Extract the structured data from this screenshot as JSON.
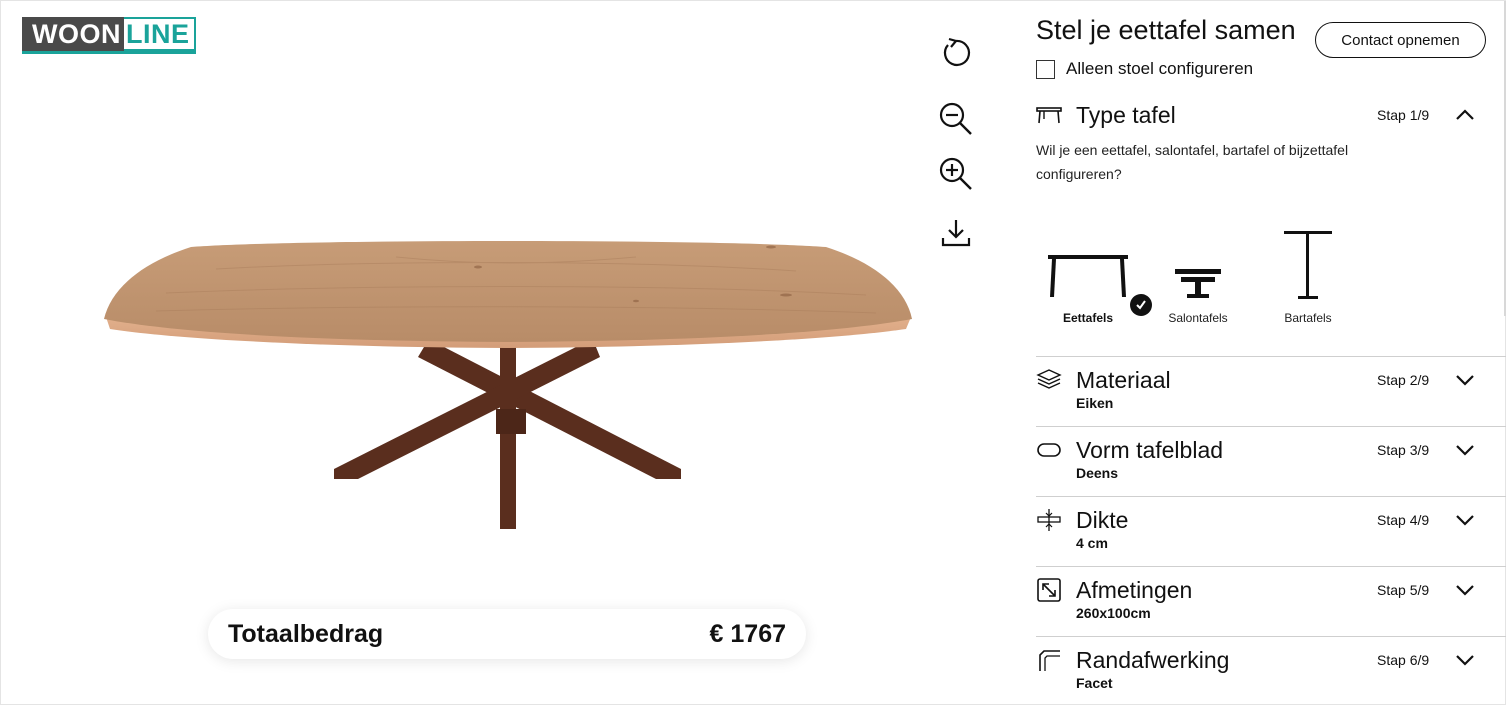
{
  "brand": {
    "logo_dark": "WOON",
    "logo_light": "LINE"
  },
  "viewer": {
    "tools": [
      "rotate-icon",
      "zoom-out-icon",
      "zoom-in-icon",
      "download-icon"
    ]
  },
  "price": {
    "label": "Totaalbedrag",
    "value": "€ 1767"
  },
  "panel": {
    "title": "Stel je eettafel samen",
    "contact_label": "Contact opnemen",
    "chair_only_label": "Alleen stoel configureren",
    "chair_only_checked": false
  },
  "step1": {
    "title": "Type tafel",
    "count": "Stap 1/9",
    "expanded": true,
    "question": "Wil je een eettafel, salontafel, bartafel of bijzettafel configureren?",
    "options": [
      {
        "label": "Eettafels",
        "selected": true
      },
      {
        "label": "Salontafels",
        "selected": false
      },
      {
        "label": "Bartafels",
        "selected": false
      }
    ]
  },
  "steps": [
    {
      "title": "Materiaal",
      "count": "Stap 2/9",
      "value": "Eiken",
      "icon": "layers-icon"
    },
    {
      "title": "Vorm tafelblad",
      "count": "Stap 3/9",
      "value": "Deens",
      "icon": "oval-shape-icon"
    },
    {
      "title": "Dikte",
      "count": "Stap 4/9",
      "value": "4 cm",
      "icon": "thickness-icon"
    },
    {
      "title": "Afmetingen",
      "count": "Stap 5/9",
      "value": "260x100cm",
      "icon": "resize-icon"
    },
    {
      "title": "Randafwerking",
      "count": "Stap 6/9",
      "value": "Facet",
      "icon": "edge-profile-icon"
    }
  ],
  "colors": {
    "brand_teal": "#1aa39a",
    "brand_dark": "#4a4a4a",
    "wood": "#c49a76",
    "steel": "#5a2e1e"
  }
}
